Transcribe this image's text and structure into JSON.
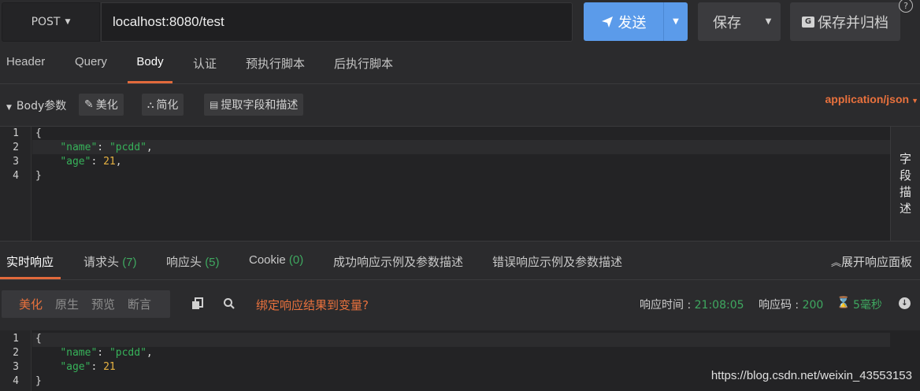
{
  "request": {
    "method": "POST",
    "url": "localhost:8080/test",
    "send_label": "发送",
    "save_label": "保存",
    "save_archive_label": "保存并归档",
    "help_label": "?"
  },
  "request_tabs": [
    "Header",
    "Query",
    "Body",
    "认证",
    "预执行脚本",
    "后执行脚本"
  ],
  "body_toolbar": {
    "section_label": "Body参数",
    "beautify_label": "美化",
    "simplify_label": "简化",
    "extract_label": "提取字段和描述",
    "content_type": "application/json"
  },
  "request_body": {
    "line_numbers": [
      "1",
      "2",
      "3",
      "4"
    ],
    "lines": [
      [
        {
          "t": "{",
          "c": "p"
        }
      ],
      [
        {
          "t": "    ",
          "c": "p"
        },
        {
          "t": "\"name\"",
          "c": "k"
        },
        {
          "t": ": ",
          "c": "p"
        },
        {
          "t": "\"pcdd\"",
          "c": "s"
        },
        {
          "t": ",",
          "c": "p"
        }
      ],
      [
        {
          "t": "    ",
          "c": "p"
        },
        {
          "t": "\"age\"",
          "c": "k"
        },
        {
          "t": ": ",
          "c": "p"
        },
        {
          "t": "21",
          "c": "n"
        },
        {
          "t": ",",
          "c": "p"
        }
      ],
      [
        {
          "t": "}",
          "c": "p"
        }
      ]
    ]
  },
  "field_desc_label": [
    "字",
    "段",
    "描",
    "述"
  ],
  "response_tabs": {
    "realtime": "实时响应",
    "req_headers": "请求头",
    "req_headers_count": "(7)",
    "rsp_headers": "响应头",
    "rsp_headers_count": "(5)",
    "cookie": "Cookie",
    "cookie_count": "(0)",
    "success_example": "成功响应示例及参数描述",
    "error_example": "错误响应示例及参数描述",
    "expand_label": "展开响应面板"
  },
  "response_toolbar": {
    "formats": [
      "美化",
      "原生",
      "预览",
      "断言"
    ],
    "bind_link": "绑定响应结果到变量?",
    "time_label": "响应时间 : ",
    "time_value": "21:08:05",
    "code_label": "响应码 : ",
    "code_value": "200",
    "duration": "5毫秒"
  },
  "response_body": {
    "line_numbers": [
      "1",
      "2",
      "3",
      "4"
    ],
    "lines": [
      [
        {
          "t": "{",
          "c": "p"
        }
      ],
      [
        {
          "t": "    ",
          "c": "p"
        },
        {
          "t": "\"name\"",
          "c": "k"
        },
        {
          "t": ": ",
          "c": "p"
        },
        {
          "t": "\"pcdd\"",
          "c": "s"
        },
        {
          "t": ",",
          "c": "p"
        }
      ],
      [
        {
          "t": "    ",
          "c": "p"
        },
        {
          "t": "\"age\"",
          "c": "k"
        },
        {
          "t": ": ",
          "c": "p"
        },
        {
          "t": "21",
          "c": "n"
        }
      ],
      [
        {
          "t": "}",
          "c": "p"
        }
      ]
    ]
  },
  "watermark": "https://blog.csdn.net/weixin_43553153",
  "colors": {
    "accent": "#e26a3c",
    "send": "#5b9bea",
    "green": "#3fa860"
  }
}
